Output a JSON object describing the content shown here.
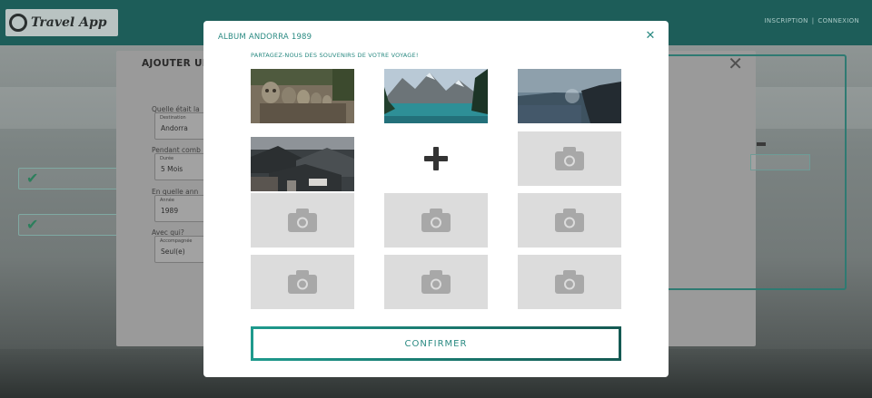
{
  "app": {
    "logo_text": "Travel App",
    "nav": [
      "INSCRIPTION",
      "CONNEXION"
    ]
  },
  "background_form": {
    "title": "AJOUTER UN",
    "questions": [
      {
        "label": "Quelle était la",
        "field_label": "Destination",
        "value": "Andorra"
      },
      {
        "label": "Pendant comb",
        "field_label": "Durée",
        "value": "5 Mois"
      },
      {
        "label": "En quelle ann",
        "field_label": "Année",
        "value": "1989"
      },
      {
        "label": "Avec qui?",
        "field_label": "Accompagnée",
        "value": "Seul(e)"
      }
    ]
  },
  "modal": {
    "title": "ALBUM ANDORRA 1989",
    "subtitle": "PARTAGEZ-NOUS DES SOUVENIRS DE VOTRE VOYAGE!",
    "confirm_label": "CONFIRMER"
  },
  "colors": {
    "accent": "#2a8a82",
    "header": "#1d5d59",
    "placeholder": "#dcdcdc"
  },
  "icons": {
    "close": "close-icon",
    "add": "plus-icon",
    "placeholder": "camera-icon"
  }
}
